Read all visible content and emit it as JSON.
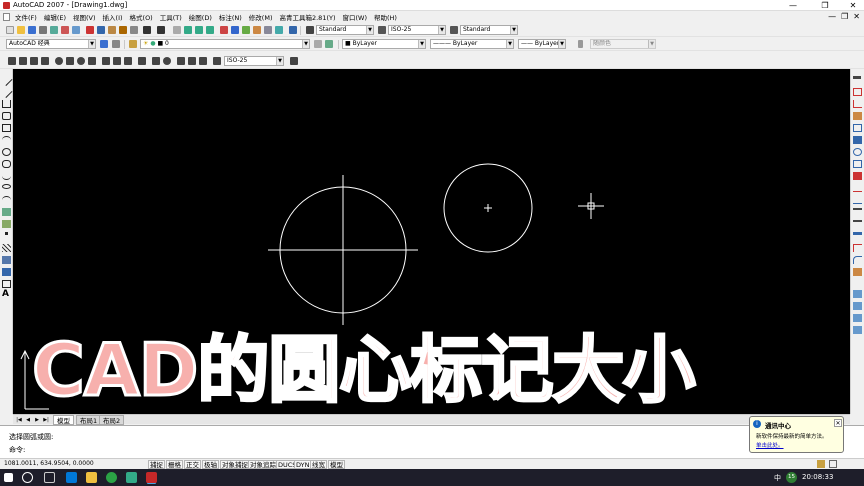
{
  "window": {
    "title": "AutoCAD 2007 - [Drawing1.dwg]",
    "controls": {
      "minimize": "—",
      "restore": "❐",
      "close": "✕"
    }
  },
  "menu": {
    "items": [
      "文件(F)",
      "编辑(E)",
      "视图(V)",
      "插入(I)",
      "格式(O)",
      "工具(T)",
      "绘图(D)",
      "标注(N)",
      "修改(M)",
      "高青工具箱2.81(Y)",
      "窗口(W)",
      "帮助(H)"
    ],
    "doc_controls": {
      "minimize": "—",
      "restore": "❐",
      "close": "✕"
    }
  },
  "toolbar": {
    "text_style": "Standard",
    "dim_style": "ISO-25",
    "table_style": "Standard",
    "workspace": "AutoCAD 经典",
    "layer": "0",
    "color": "ByLayer",
    "linetype": "ByLayer",
    "lineweight": "ByLayer",
    "plot_style": "随颜色",
    "dim_style_2": "ISO-25"
  },
  "caption": "CAD的圆心标记大小",
  "tabs": {
    "model": "模型",
    "layout1": "布局1",
    "layout2": "布局2"
  },
  "command": {
    "line1": "选择圆弧或圆:",
    "line2": "命令:"
  },
  "status": {
    "coords": "1081.0011, 634.9504, 0.0000",
    "buttons": [
      "捕捉",
      "栅格",
      "正交",
      "极轴",
      "对象捕捉",
      "对象追踪",
      "DUCS",
      "DYN",
      "线宽",
      "模型"
    ]
  },
  "notification": {
    "title": "通讯中心",
    "message": "新软件保持最新的简单方法。",
    "link": "单击此处。",
    "close": "✕"
  },
  "taskbar": {
    "ime": "中",
    "badge": "15",
    "clock": "20:08:33"
  },
  "colors": {
    "canvas": "#000000",
    "entity": "#ffffff",
    "caption_fill": "#f7b0ad",
    "caption_stroke": "#ffffff",
    "taskbar": "#1e1e2a"
  }
}
